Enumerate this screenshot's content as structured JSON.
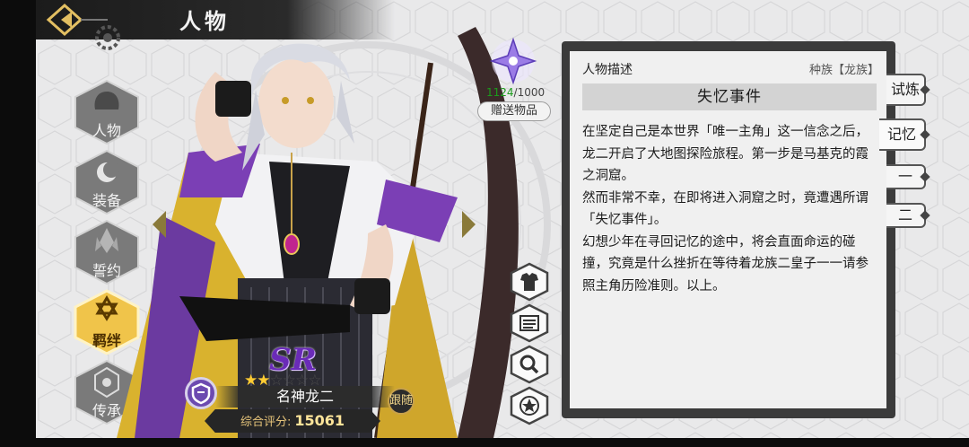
{
  "header": {
    "title": "人物",
    "back_label": "返回"
  },
  "nav": [
    {
      "label": "人物",
      "icon": "helmet-icon",
      "active": false
    },
    {
      "label": "装备",
      "icon": "moon-emblem-icon",
      "active": false
    },
    {
      "label": "誓约",
      "icon": "crystal-icon",
      "active": false
    },
    {
      "label": "羁绊",
      "icon": "hexagram-icon",
      "active": true
    },
    {
      "label": "传承",
      "icon": "eye-hexagon-icon",
      "active": false
    }
  ],
  "gift": {
    "current": "1124",
    "max": "/1000",
    "button_label": "赠送物品",
    "icon": "star-flower-icon"
  },
  "actions": [
    {
      "icon": "costume-icon"
    },
    {
      "icon": "list-card-icon"
    },
    {
      "icon": "magnifier-icon"
    },
    {
      "icon": "star-badge-icon"
    }
  ],
  "character": {
    "rarity": "SR",
    "stars_filled": 2,
    "stars_total": 6,
    "name": "名神龙二",
    "follow_label": "跟随",
    "score_label": "综合评分:",
    "score_value": "15061"
  },
  "panel": {
    "heading": "人物描述",
    "race": "种族【龙族】",
    "subtitle": "失忆事件",
    "paragraphs": [
      "在坚定自己是本世界「唯一主角」这一信念之后，龙二开启了大地图探险旅程。第一步是马基克的霞之洞窟。",
      "然而非常不幸，在即将进入洞窟之时，竟遭遇所谓「失忆事件」。",
      "幻想少年在寻回记忆的途中，将会直面命运的碰撞，究竟是什么挫折在等待着龙族二皇子一一请参照主角历险准则。以上。"
    ]
  },
  "tabs": [
    {
      "label": "试炼",
      "active": false
    },
    {
      "label": "记忆",
      "active": true
    },
    {
      "label": "一",
      "active": false
    },
    {
      "label": "二",
      "active": false
    }
  ],
  "colors": {
    "accent_gold": "#e8b93a",
    "panel_dark": "#3b3b3b",
    "rarity_purple": "#6a2bb8"
  }
}
